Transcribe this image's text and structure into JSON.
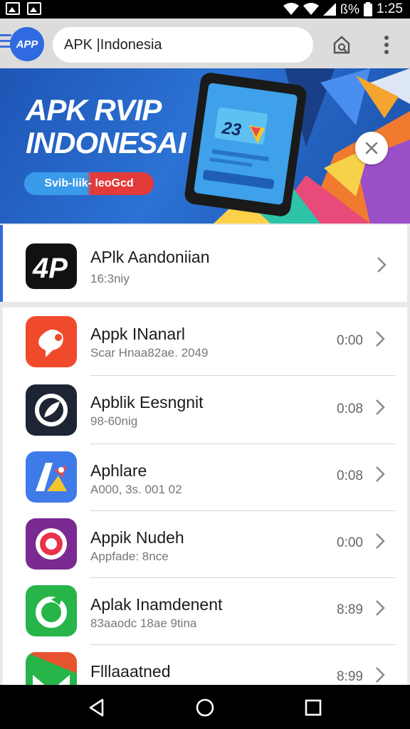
{
  "status_bar": {
    "battery_text": "ß%",
    "time": "1:25"
  },
  "app_bar": {
    "logo_text": "APP",
    "search_value": "APK |Indonesia"
  },
  "banner": {
    "title_line1": "APK RVIP",
    "title_line2": "INDONESAI",
    "cta_label": "Svib-liik- leoGcd",
    "phone_number": "23"
  },
  "featured": {
    "title": "APlk Aandoniian",
    "subtitle": "16:3niy"
  },
  "apps": [
    {
      "title": "Appk INanarl",
      "subtitle": "Scar Hnaa82ae. 2049",
      "time": "0:00",
      "color": "#ef4a2c"
    },
    {
      "title": "Apblik Eesngnit",
      "subtitle": "98-60nig",
      "time": "0:08",
      "color": "#1d2433"
    },
    {
      "title": "Aphlare",
      "subtitle": "A000, 3s. 001 02",
      "time": "0:08",
      "color": "#3f7be8"
    },
    {
      "title": "Appik Nudeh",
      "subtitle": "Appfade: 8nce",
      "time": "0:00",
      "color": "#7a2a92"
    },
    {
      "title": "Aplak Inamdenent",
      "subtitle": "83aaodc 18ae 9tina",
      "time": "8:89",
      "color": "#27b54a"
    },
    {
      "title": "Flllaaatned",
      "subtitle": "",
      "time": "8:99",
      "color": "#e8532f"
    }
  ],
  "colors": {
    "accent": "#2f6ae0",
    "banner_bg": "#1e56b5",
    "cta_red": "#e33a3a"
  }
}
